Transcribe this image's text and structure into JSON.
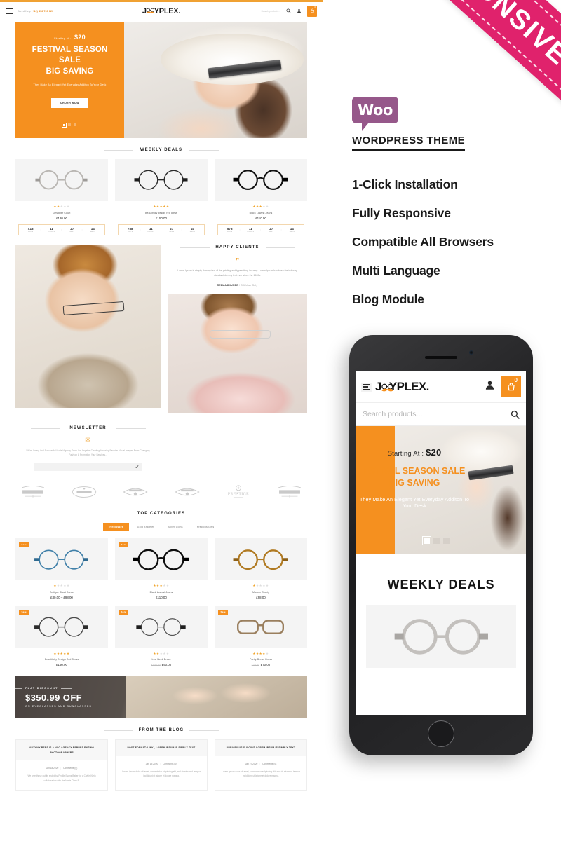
{
  "left_preview": {
    "header": {
      "need_help_label": "Need Help",
      "phone": "(+12) 456 789 123",
      "brand": {
        "part1": "J",
        "part2": "YPLEX."
      },
      "search_placeholder": "Search products...",
      "cart_count": "0"
    },
    "hero": {
      "starting_label": "Starting At :",
      "price": "$20",
      "title_line1": "FESTIVAL SEASON SALE",
      "title_line2": "BIG SAVING",
      "subtitle": "They Make An Elegant Yet Everyday Additon To Your Desk",
      "cta": "ORDER NOW"
    },
    "weekly_deals": {
      "title": "WEEKLY DEALS",
      "products": [
        {
          "name": "Designer Court",
          "price": "£120.00",
          "stars": 2,
          "timer": {
            "days": "418",
            "hours": "11",
            "mins": "27",
            "secs": "14"
          }
        },
        {
          "name": "Beautifully design red dress",
          "price": "£150.00",
          "stars": 5,
          "timer": {
            "days": "788",
            "hours": "11",
            "mins": "27",
            "secs": "14"
          }
        },
        {
          "name": "Black Lowest Jeans",
          "price": "£110.00",
          "stars": 3,
          "timer": {
            "days": "578",
            "hours": "11",
            "mins": "27",
            "secs": "14"
          }
        }
      ],
      "timer_labels": {
        "days": "DAYS",
        "hours": "HOURS",
        "mins": "MINS",
        "secs": "SECS"
      }
    },
    "happy_clients": {
      "title": "HAPPY CLIENTS",
      "quote_mark": "❞",
      "body": "Lorem Ipsum is simply dummy text of the printing and typesetting industry. Lorem Ipsum has been the industry standard dummy text ever since the 1500s.",
      "author": "REEMA DHURDE",
      "role": "Gift User Only"
    },
    "newsletter": {
      "title": "NEWSLETTER",
      "body": "We're Young And Successful Model Agency From Los Angeles Creating Amazing Fashion Visual Images From Changing Fashion & Promotion Your Services...",
      "input_value": ""
    },
    "brands": [
      "business",
      "photography",
      "letterpress",
      "letterpress",
      "prestige",
      "business"
    ],
    "top_categories": {
      "title": "TOP CATEGORIES",
      "tabs": [
        "Eyeglasses",
        "Gold Bracelet",
        "Silver Coins",
        "Precious Gifts"
      ],
      "active_tab": "Eyeglasses",
      "sale_label": "Sale",
      "products": [
        {
          "name": "Antique Short Dress",
          "price": "£80.00 – £98.00",
          "stars": 1,
          "sale": true
        },
        {
          "name": "Black Lowest Jeans",
          "price": "£110.00",
          "stars": 3,
          "sale": true
        },
        {
          "name": "Maroon Shorty",
          "price": "£98.00",
          "stars": 1,
          "sale": false
        },
        {
          "name": "Beautifully Design Red Dress",
          "price": "£150.00",
          "old_price": "",
          "stars": 5,
          "sale": true
        },
        {
          "name": "Low Neck Dress",
          "price": "£90.00",
          "old_price": "£100.00",
          "stars": 2,
          "sale": true
        },
        {
          "name": "Pretty Brown Dress",
          "price": "£70.00",
          "old_price": "£70.00",
          "stars": 4,
          "sale": true
        }
      ]
    },
    "promo": {
      "flat": "FLAT DISCOUNT",
      "amount": "$350.99 OFF",
      "sub": "ON EYEGLASSES AND SUNGLASSES"
    },
    "blog": {
      "title": "FROM THE BLOG",
      "posts": [
        {
          "title": "ANYWAY REPS IS A NYC AGENCY REPRES ENTING PHOTOGRAPHERS",
          "date": "Jan 18,2020",
          "comments": "Comments (0)",
          "excerpt": "We love these outfits styled by Phyllis Evans Baker for a Calvin Klein collaboration with the Maria Clara B."
        },
        {
          "title": "POST FORMAT: LINK , LOREM IPSUM IS SIMPLY TEXT",
          "date": "Jan 19,2020",
          "comments": "Comments (0)",
          "excerpt": "Lorem ipsum dolor sit amet, consectetur adipiscing elit, sed do eiusmod tempor incididunt ut labore et dolore magna."
        },
        {
          "title": "URNA RISUS SUSCIPIT LOREM IPSUM IS SIMPLY TEXT",
          "date": "Jan 27,2020",
          "comments": "Comments (0)",
          "excerpt": "Lorem ipsum dolor sit amet, consectetur adipiscing elit, sed do eiusmod tempor incididunt ut labore et dolore magna."
        }
      ]
    }
  },
  "marketing": {
    "ribbon_label": "RESPONSIVE",
    "woo_label": "Woo",
    "wordpress_theme": "WORDPRESS THEME",
    "features": [
      "1-Click Installation",
      "Fully Responsive",
      "Compatible All Browsers",
      "Multi Language",
      "Blog Module"
    ],
    "colors": {
      "ribbon": "#e0226c",
      "accent": "#f5901f",
      "woo_purple": "#96588a"
    }
  },
  "phone_preview": {
    "brand": {
      "part1": "J",
      "part2": "YPLEX."
    },
    "search_placeholder": "Search products...",
    "cart_count": "0",
    "hero": {
      "starting_label": "Starting At :",
      "price": "$20",
      "title_line1": "ESTIVAL SEASON SALE",
      "title_line2": "BIG SAVING",
      "subtitle": "They Make An Elegant Yet Everyday Additon To Your Desk"
    },
    "deals_title": "WEEKLY DEALS"
  }
}
